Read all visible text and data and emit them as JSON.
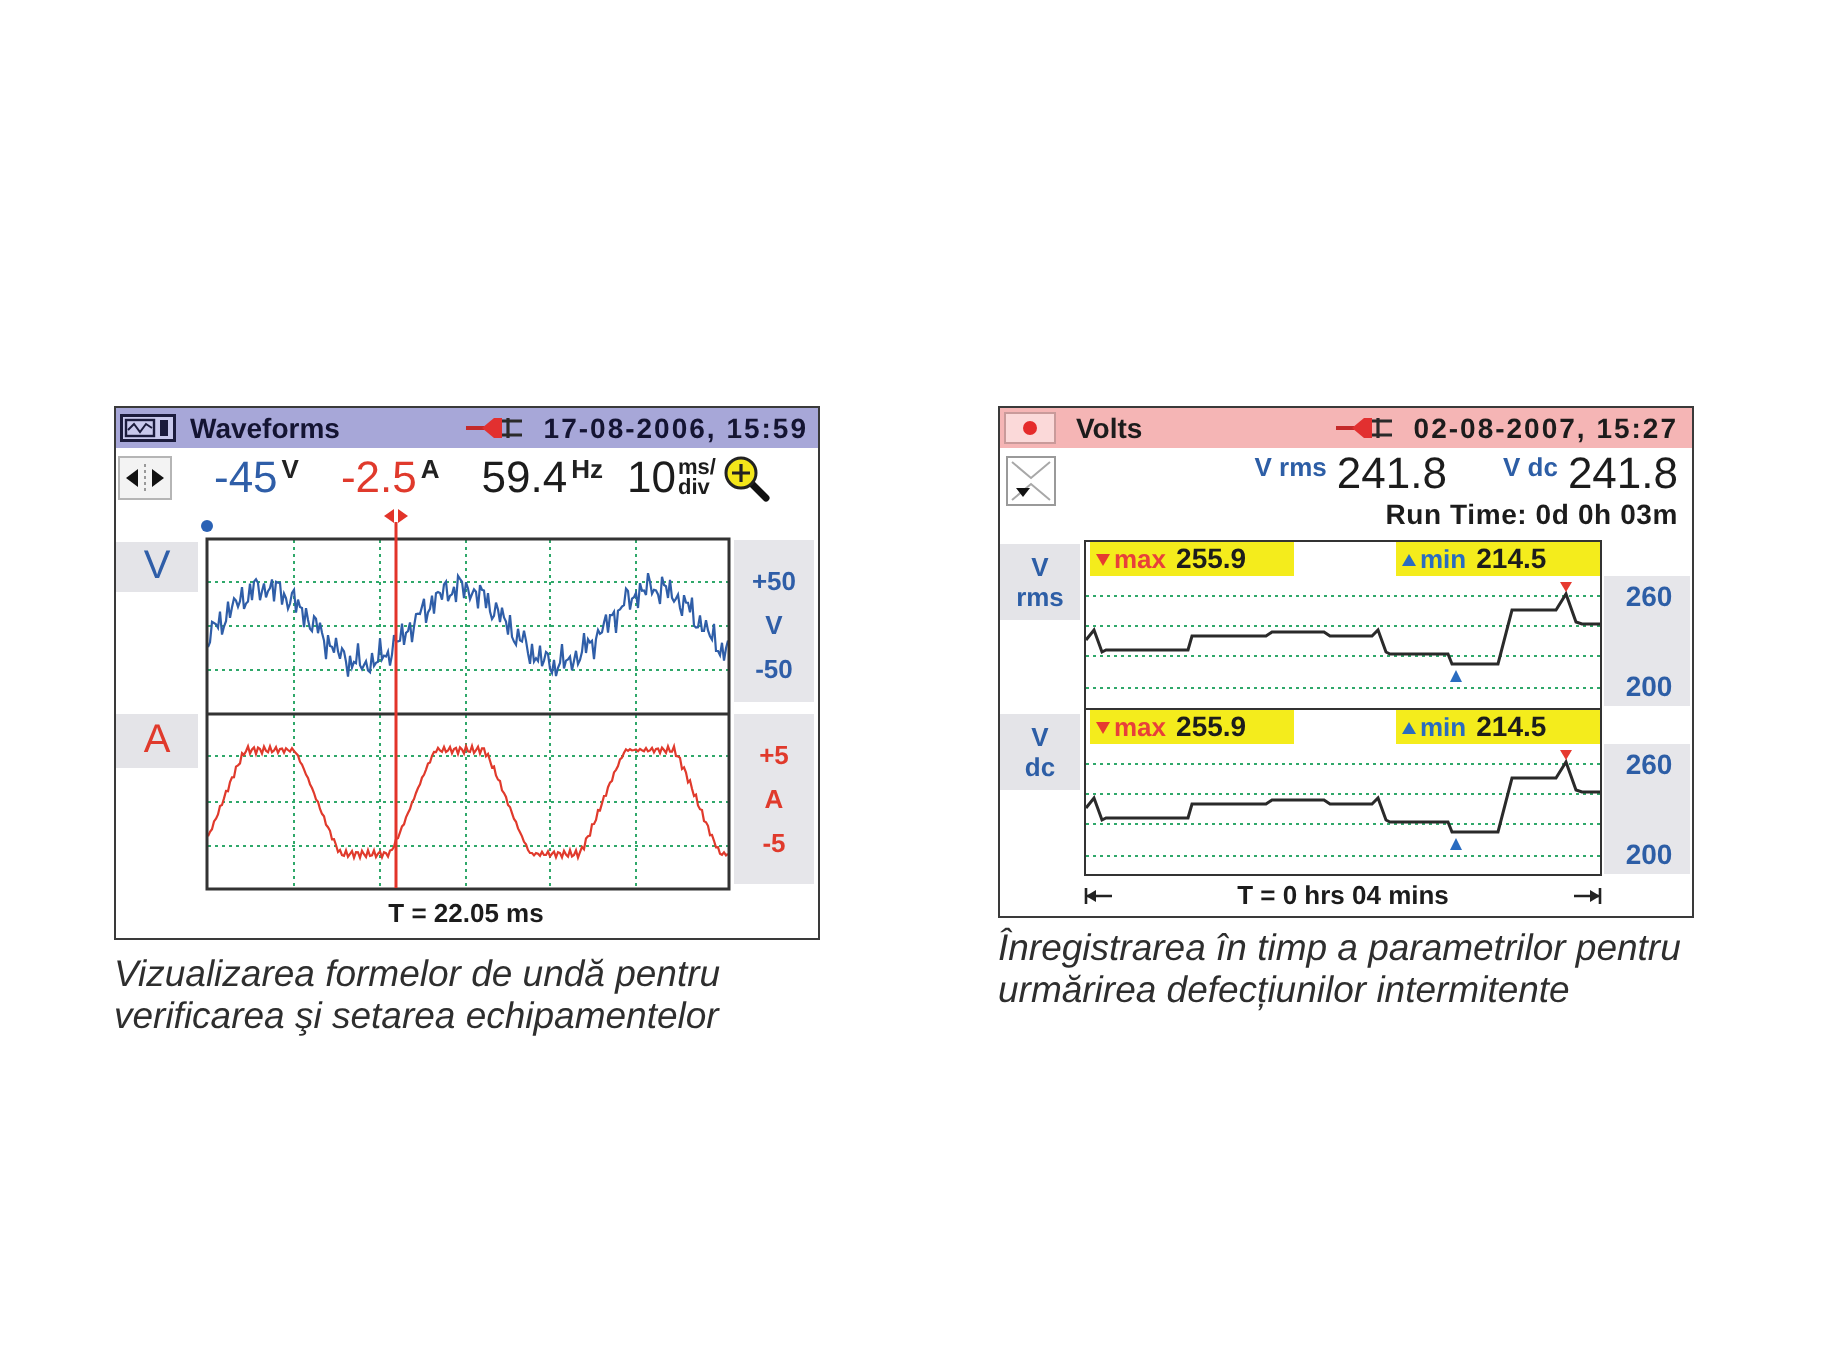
{
  "screens": [
    {
      "kind": "waveform",
      "title": "Waveforms",
      "datetime": "17-08-2006, 15:59",
      "readings": [
        {
          "value": "-45",
          "unit": "V",
          "color": "#2f5ea8"
        },
        {
          "value": "-2.5",
          "unit": "A",
          "color": "#e03a2c"
        },
        {
          "value": "59.4",
          "unit": "Hz",
          "color": "#1c1c1c"
        }
      ],
      "timebase": {
        "value": "10",
        "unit_top": "ms/",
        "unit_bottom": "div"
      },
      "traces": [
        {
          "label": "V",
          "color": "#2f5ea8",
          "scale": [
            "+50",
            "V",
            "-50"
          ]
        },
        {
          "label": "A",
          "color": "#e03a2c",
          "scale": [
            "+5",
            "A",
            "-5"
          ]
        }
      ],
      "time_span": "T = 22.05 ms",
      "caption": [
        "Vizualizarea formelor de undă pentru",
        "verificarea şi setarea echipamentelor"
      ]
    },
    {
      "kind": "trend",
      "title": "Volts",
      "datetime": "02-08-2007, 15:27",
      "values": [
        {
          "label": "V rms",
          "value": "241.8"
        },
        {
          "label": "V dc",
          "value": "241.8"
        }
      ],
      "run_time": "Run Time: 0d 0h 03m",
      "channels": [
        {
          "label": [
            "V",
            "rms"
          ],
          "max_label": "max",
          "max_value": "255.9",
          "min_label": "min",
          "min_value": "214.5",
          "scale": [
            "260",
            "200"
          ]
        },
        {
          "label": [
            "V",
            "dc"
          ],
          "max_label": "max",
          "max_value": "255.9",
          "min_label": "min",
          "min_value": "214.5",
          "scale": [
            "260",
            "200"
          ]
        }
      ],
      "time_span": "T = 0 hrs 04 mins",
      "caption": [
        "Înregistrarea în timp a parametrilor pentru",
        "urmărirea defecțiunilor intermitente"
      ]
    }
  ]
}
